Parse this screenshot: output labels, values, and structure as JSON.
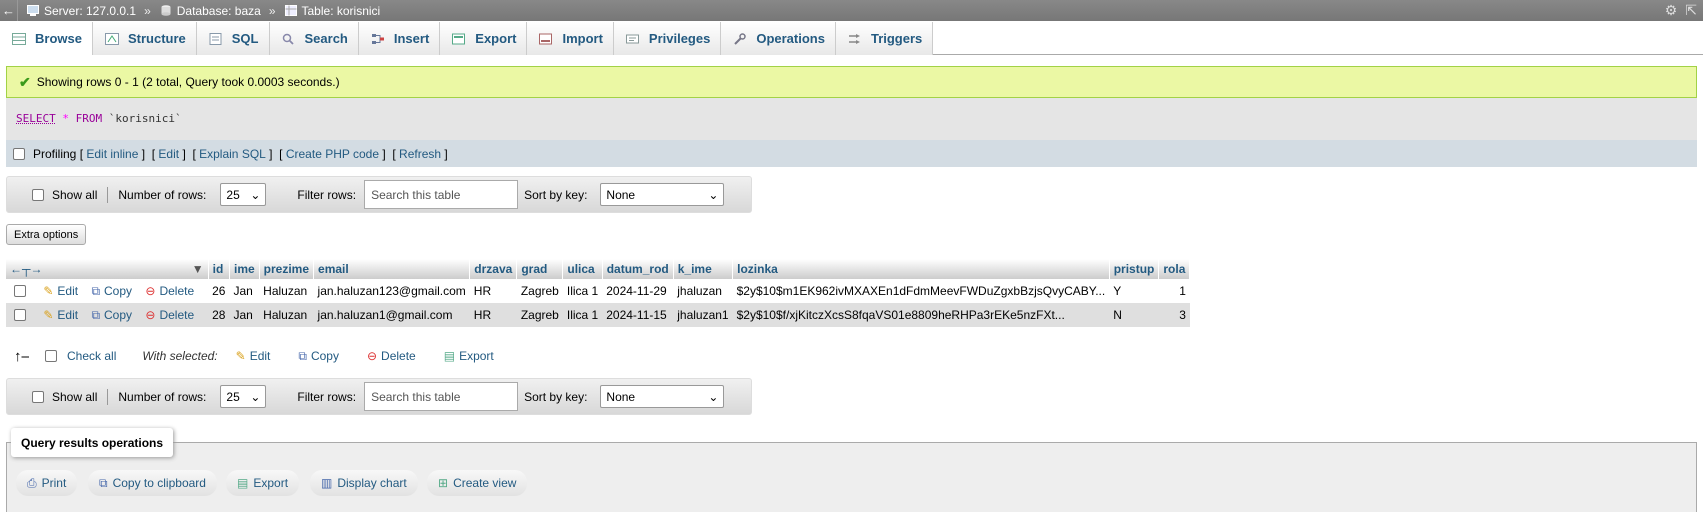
{
  "breadcrumb": {
    "server": "Server: 127.0.0.1",
    "database": "Database: baza",
    "table": "Table: korisnici",
    "separator": "»"
  },
  "tabs": [
    {
      "label": "Browse",
      "icon": "browse-icon"
    },
    {
      "label": "Structure",
      "icon": "structure-icon"
    },
    {
      "label": "SQL",
      "icon": "sql-icon"
    },
    {
      "label": "Search",
      "icon": "search-icon"
    },
    {
      "label": "Insert",
      "icon": "insert-icon"
    },
    {
      "label": "Export",
      "icon": "export-icon"
    },
    {
      "label": "Import",
      "icon": "import-icon"
    },
    {
      "label": "Privileges",
      "icon": "privileges-icon"
    },
    {
      "label": "Operations",
      "icon": "operations-icon"
    },
    {
      "label": "Triggers",
      "icon": "triggers-icon"
    }
  ],
  "success_message": "Showing rows 0 - 1 (2 total, Query took 0.0003 seconds.)",
  "sql": {
    "select": "SELECT",
    "star": "*",
    "from": "FROM",
    "table": "`korisnici`"
  },
  "profiling": {
    "label": "Profiling",
    "edit_inline": "Edit inline",
    "edit": "Edit",
    "explain": "Explain SQL",
    "php": "Create PHP code",
    "refresh": "Refresh"
  },
  "nav": {
    "show_all": "Show all",
    "num_rows_label": "Number of rows:",
    "num_rows_value": "25",
    "filter_label": "Filter rows:",
    "filter_placeholder": "Search this table",
    "sort_label": "Sort by key:",
    "sort_value": "None"
  },
  "extra_options": "Extra options",
  "table": {
    "columns": [
      "id",
      "ime",
      "prezime",
      "email",
      "drzava",
      "grad",
      "ulica",
      "datum_rod",
      "k_ime",
      "lozinka",
      "pristup",
      "rola"
    ],
    "row_actions": {
      "edit": "Edit",
      "copy": "Copy",
      "delete": "Delete"
    },
    "rows": [
      [
        "26",
        "Jan",
        "Haluzan",
        "jan.haluzan123@gmail.com",
        "HR",
        "Zagreb",
        "Ilica 1",
        "2024-11-29",
        "jhaluzan",
        "$2y$10$m1EK962ivMXAXEn1dFdmMeevFWDuZgxbBzjsQvyCABY...",
        "Y",
        "1"
      ],
      [
        "28",
        "Jan",
        "Haluzan",
        "jan.haluzan1@gmail.com",
        "HR",
        "Zagreb",
        "Ilica 1",
        "2024-11-15",
        "jhaluzan1",
        "$2y$10$f/xjKitczXcsS8fqaVS01e8809heRHPa3rEKe5nzFXt...",
        "N",
        "3"
      ]
    ]
  },
  "with_selected": {
    "check_all": "Check all",
    "label": "With selected:",
    "edit": "Edit",
    "copy": "Copy",
    "delete": "Delete",
    "export": "Export"
  },
  "query_ops": {
    "legend": "Query results operations",
    "print": "Print",
    "copy": "Copy to clipboard",
    "export": "Export",
    "chart": "Display chart",
    "view": "Create view"
  }
}
